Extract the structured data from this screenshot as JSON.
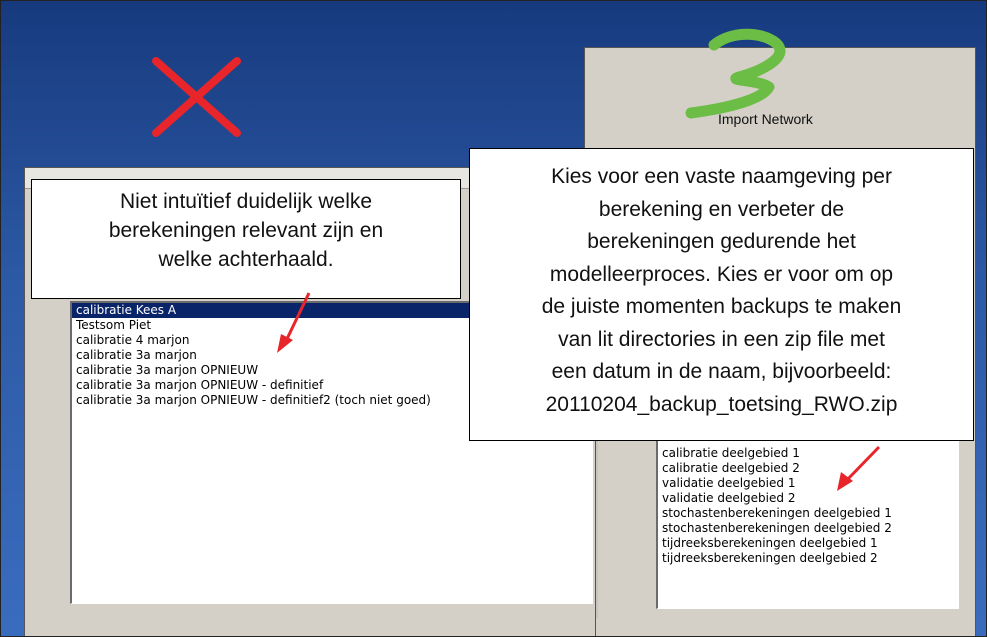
{
  "right_window": {
    "button_label": "Import Network",
    "list_items": [
      "calibratie deelgebied 1",
      "calibratie deelgebied 2",
      "validatie deelgebied 1",
      "validatie deelgebied 2",
      "stochastenberekeningen deelgebied 1",
      "stochastenberekeningen deelgebied 2",
      "tijdreeksberekeningen deelgebied 1",
      "tijdreeksberekeningen deelgebied 2"
    ]
  },
  "left_window": {
    "list_items": [
      {
        "label": "calibratie Kees A",
        "selected": true
      },
      {
        "label": "Testsom Piet",
        "selected": false
      },
      {
        "label": "calibratie 4 marjon",
        "selected": false
      },
      {
        "label": "calibratie 3a marjon",
        "selected": false
      },
      {
        "label": "calibratie 3a marjon OPNIEUW",
        "selected": false
      },
      {
        "label": "calibratie 3a marjon OPNIEUW - definitief",
        "selected": false
      },
      {
        "label": "calibratie 3a marjon OPNIEUW - definitief2 (toch niet goed)",
        "selected": false
      }
    ]
  },
  "callout_left": {
    "lines": [
      "Niet intuïtief duidelijk welke",
      "berekeningen relevant zijn en",
      "welke achterhaald."
    ]
  },
  "callout_right": {
    "lines": [
      "Kies voor een vaste naamgeving per",
      "berekening en verbeter de",
      "berekeningen gedurende het",
      "modelleerproces. Kies er voor om op",
      "de juiste momenten backups te maken",
      "van lit directories in een zip file met",
      "een datum in de naam, bijvoorbeeld:",
      "20110204_backup_toetsing_RWO.zip"
    ]
  },
  "marks": {
    "cross_color": "#e8252a",
    "check_color": "#6cbd45",
    "arrow_color": "#e8252a"
  }
}
